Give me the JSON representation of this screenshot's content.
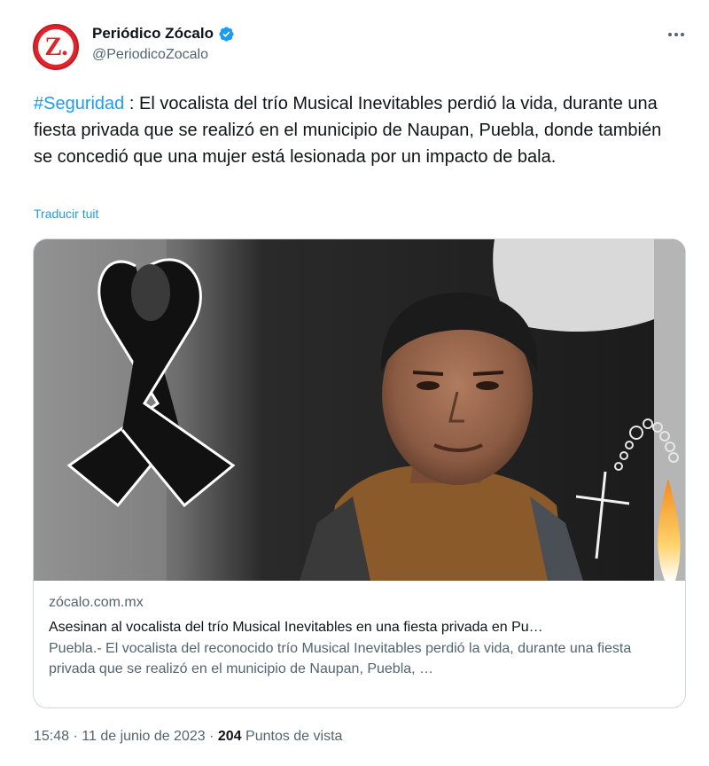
{
  "author": {
    "display_name": "Periódico Zócalo",
    "handle": "@PeriodicoZocalo",
    "avatar_letter": "Z.",
    "verified": true,
    "avatar_color": "#e0242b",
    "verified_color": "#1d9bf0"
  },
  "tweet": {
    "hashtag": "#Seguridad",
    "text": " : El vocalista del trío Musical Inevitables perdió la vida, durante una fiesta privada que se realizó en el municipio de Naupan, Puebla, donde también se concedió que una mujer está lesionada por un impacto de bala.",
    "translate_label": "Traducir tuit"
  },
  "card": {
    "domain": "zócalo.com.mx",
    "title": "Asesinan al vocalista del trío Musical Inevitables en una fiesta privada en Pu…",
    "description": "Puebla.- El vocalista del reconocido trío Musical Inevitables perdió la vida, durante una fiesta privada que se realizó en el municipio de Naupan, Puebla, …"
  },
  "meta": {
    "time": "15:48",
    "separator": " · ",
    "date": "11 de junio de 2023",
    "views_count": "204",
    "views_label": " Puntos de vista"
  },
  "icons": {
    "more": "more-options-icon",
    "verified": "verified-badge-icon"
  },
  "colors": {
    "link": "#1d9bf0",
    "secondary_text": "#536471",
    "border": "#cfd9de"
  }
}
